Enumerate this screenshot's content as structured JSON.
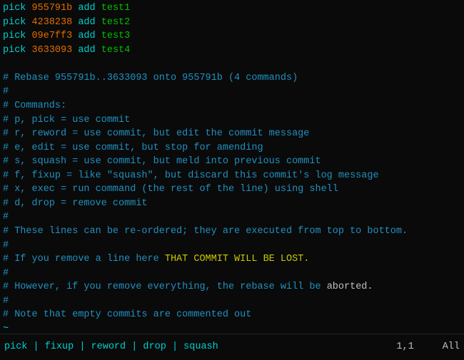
{
  "editor": {
    "lines": [
      {
        "type": "commit",
        "keyword": "pick",
        "hash": "955791b",
        "msg": " add test1"
      },
      {
        "type": "commit",
        "keyword": "pick",
        "hash": "4238238",
        "msg": " add test2"
      },
      {
        "type": "commit",
        "keyword": "pick",
        "hash": "09e7ff3",
        "msg": " add test3"
      },
      {
        "type": "commit",
        "keyword": "pick",
        "hash": "3633093",
        "msg": " add test4"
      },
      {
        "type": "blank"
      },
      {
        "type": "comment",
        "text": "# Rebase 955791b..3633093 onto 955791b (4 commands)"
      },
      {
        "type": "comment",
        "text": "#"
      },
      {
        "type": "comment",
        "text": "# Commands:"
      },
      {
        "type": "comment",
        "text": "# p, pick = use commit"
      },
      {
        "type": "comment",
        "text": "# r, reword = use commit, but edit the commit message"
      },
      {
        "type": "comment",
        "text": "# e, edit = use commit, but stop for amending"
      },
      {
        "type": "comment",
        "text": "# s, squash = use commit, but meld into previous commit"
      },
      {
        "type": "comment",
        "text": "# f, fixup = like \"squash\", but discard this commit's log message"
      },
      {
        "type": "comment",
        "text": "# x, exec = run command (the rest of the line) using shell"
      },
      {
        "type": "comment",
        "text": "# d, drop = remove commit"
      },
      {
        "type": "comment",
        "text": "#"
      },
      {
        "type": "comment",
        "text": "# These lines can be re-ordered; they are executed from top to bottom."
      },
      {
        "type": "comment",
        "text": "#"
      },
      {
        "type": "comment",
        "text": "# If you remove a line here THAT COMMIT WILL BE LOST."
      },
      {
        "type": "comment",
        "text": "#"
      },
      {
        "type": "comment",
        "text": "# However, if you remove everything, the rebase will be aborted."
      },
      {
        "type": "comment",
        "text": "#"
      },
      {
        "type": "comment",
        "text": "# Note that empty commits are commented out"
      },
      {
        "type": "tilde"
      },
      {
        "type": "tilde"
      }
    ]
  },
  "statusbar": {
    "commands": "pick | fixup | reword | drop | squash",
    "position": "1,1",
    "scroll": "All"
  }
}
